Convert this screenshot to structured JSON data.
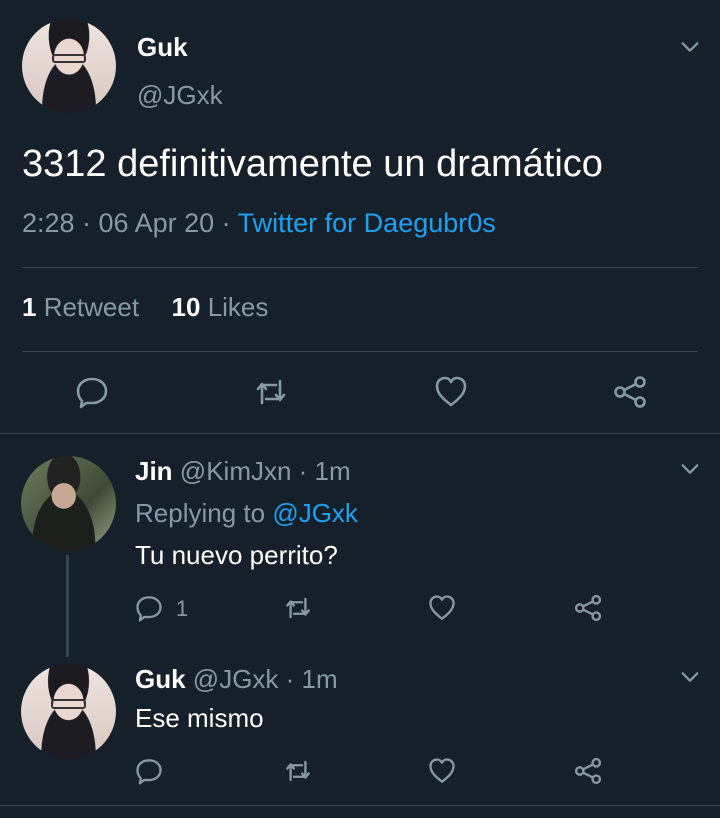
{
  "main": {
    "name": "Guk",
    "handle": "@JGxk",
    "text": "3312 definitivamente un dramático",
    "time": "2:28 · 06 Apr 20 · ",
    "source": "Twitter for Daegubr0s",
    "retweets_count": "1",
    "retweets_label": " Retweet",
    "likes_count": "10",
    "likes_label": " Likes"
  },
  "replies": [
    {
      "name": "Jin",
      "handle_time": " @KimJxn · 1m",
      "replying_label": "Replying to ",
      "replying_to": "@JGxk",
      "text": "Tu nuevo perrito?",
      "reply_count": "1"
    },
    {
      "name": "Guk",
      "handle_time": " @JGxk · 1m",
      "text": "Ese mismo"
    }
  ],
  "colors": {
    "background": "#15202b",
    "muted": "#8899a6",
    "link": "#1da1f2",
    "divider": "#38444d"
  },
  "icons": [
    "chevron-down-icon",
    "reply-icon",
    "retweet-icon",
    "like-icon",
    "share-icon"
  ]
}
